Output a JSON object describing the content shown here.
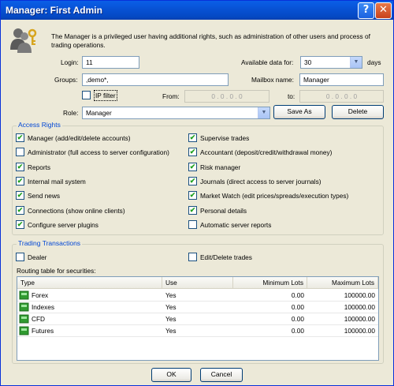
{
  "window": {
    "title": "Manager: First Admin"
  },
  "intro": "The Manager is a privileged user having additional rights, such as administration of other users and process of trading operations.",
  "form": {
    "login_label": "Login:",
    "login_value": "11",
    "groups_label": "Groups:",
    "groups_value": ",demo*,",
    "available_label": "Available data for:",
    "available_value": "30",
    "days_label": "days",
    "mailbox_label": "Mailbox name:",
    "mailbox_value": "Manager",
    "ipfilter_label": "IP filter",
    "from_label": "From:",
    "from_value": "0 . 0 . 0 . 0",
    "to_label": "to:",
    "to_value": "0 . 0 . 0 . 0",
    "role_label": "Role:",
    "role_value": "Manager",
    "save_as_label": "Save As",
    "delete_label": "Delete"
  },
  "access_rights": {
    "title": "Access Rights",
    "left": [
      {
        "label": "Manager (add/edit/delete accounts)",
        "checked": true
      },
      {
        "label": "Administrator (full access to server configuration)",
        "checked": false
      },
      {
        "label": "Reports",
        "checked": true
      },
      {
        "label": "Internal mail system",
        "checked": true
      },
      {
        "label": "Send news",
        "checked": true
      },
      {
        "label": "Connections (show online clients)",
        "checked": true
      },
      {
        "label": "Configure server plugins",
        "checked": true
      }
    ],
    "right": [
      {
        "label": "Supervise trades",
        "checked": true
      },
      {
        "label": "Accountant (deposit/credit/withdrawal money)",
        "checked": true
      },
      {
        "label": "Risk manager",
        "checked": true
      },
      {
        "label": "Journals (direct access to server journals)",
        "checked": true
      },
      {
        "label": "Market Watch (edit prices/spreads/execution types)",
        "checked": true
      },
      {
        "label": "Personal details",
        "checked": true
      },
      {
        "label": "Automatic server reports",
        "checked": false
      }
    ]
  },
  "trading": {
    "title": "Trading Transactions",
    "dealer": {
      "label": "Dealer",
      "checked": false
    },
    "edit_delete": {
      "label": "Edit/Delete trades",
      "checked": false
    },
    "routing_label": "Routing table for securities:",
    "columns": [
      "Type",
      "Use",
      "Minimum Lots",
      "Maximum Lots"
    ],
    "rows": [
      {
        "type": "Forex",
        "use": "Yes",
        "min": "0.00",
        "max": "100000.00"
      },
      {
        "type": "Indexes",
        "use": "Yes",
        "min": "0.00",
        "max": "100000.00"
      },
      {
        "type": "CFD",
        "use": "Yes",
        "min": "0.00",
        "max": "100000.00"
      },
      {
        "type": "Futures",
        "use": "Yes",
        "min": "0.00",
        "max": "100000.00"
      }
    ]
  },
  "buttons": {
    "ok": "OK",
    "cancel": "Cancel"
  },
  "icons": {
    "header": "users-keys-icon",
    "row": "green-square-icon"
  },
  "colors": {
    "titlebar": "#0853d6",
    "group_title": "#0046d5",
    "check": "#21a121"
  }
}
